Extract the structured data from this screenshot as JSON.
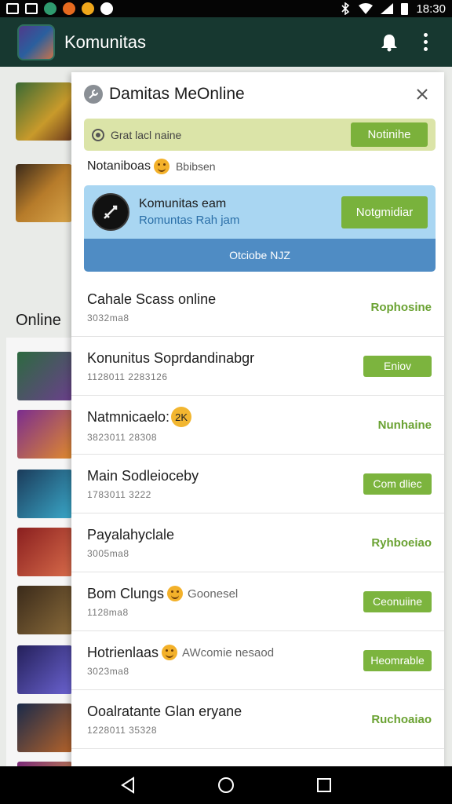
{
  "statusbar": {
    "time": "18:30",
    "icons": [
      "mail-icon",
      "image-icon",
      "app-icon",
      "app-icon",
      "app-icon",
      "app-icon",
      "bluetooth-icon",
      "wifi-icon",
      "signal-icon",
      "battery-icon"
    ]
  },
  "appbar": {
    "title": "Komunitas",
    "icons": [
      "avatar",
      "bell-icon",
      "more-vert-icon"
    ]
  },
  "background": {
    "section_label": "Online"
  },
  "panel": {
    "title": "Damitas MeOnline",
    "close_icon": "close-icon",
    "status_strip": {
      "text": "Grat lacl naine",
      "button": "Notinihe"
    },
    "subheader": {
      "title": "Notaniboas",
      "secondary": "Bbibsen"
    },
    "featured": {
      "title": "Komunitas eam",
      "subtitle": "Romuntas Rah jam",
      "button": "Notgmidiar",
      "bottom_label": "Otciobe NJZ"
    },
    "rows": [
      {
        "title": "Cahale Scass online",
        "extra": "",
        "sub": "3032ma8",
        "action": "Rophosine",
        "action_type": "text"
      },
      {
        "title": "Konunitus Soprdandinabgr",
        "extra": "",
        "sub": "1128011 2283126",
        "action": "Eniov",
        "action_type": "button"
      },
      {
        "title": "Natmnicaelo:",
        "extra": "",
        "badge": "2K",
        "sub": "3823011 28308",
        "action": "Nunhaine",
        "action_type": "text"
      },
      {
        "title": "Main Sodleioceby",
        "extra": "",
        "sub": "1783011 3222",
        "action": "Com dliec",
        "action_type": "button"
      },
      {
        "title": "Payalahyclale",
        "extra": "",
        "sub": "3005ma8",
        "action": "Ryhboeiao",
        "action_type": "text"
      },
      {
        "title": "Bom Clungs",
        "extra": "Goonesel",
        "sub": "1128ma8",
        "action": "Ceonuiine",
        "action_type": "button"
      },
      {
        "title": "Hotrienlaas",
        "extra": "AWcomie nesaod",
        "sub": "3023ma8",
        "action": "Heomrable",
        "action_type": "button"
      },
      {
        "title": "Ooalratante Glan eryane",
        "extra": "",
        "sub": "1228011 35328",
        "action": "Ruchoaiao",
        "action_type": "text"
      }
    ]
  },
  "navbar": {
    "icons": [
      "back-icon",
      "home-icon",
      "recents-icon"
    ]
  },
  "colors": {
    "appbar": "#173830",
    "accent_green": "#7bb13b",
    "featured_blue": "#a9d6f2",
    "featured_bar": "#4f8cc4",
    "status_strip": "#dbe4a8"
  }
}
